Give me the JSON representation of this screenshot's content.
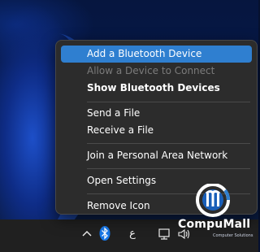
{
  "menu": {
    "items": [
      {
        "label": "Add a Bluetooth Device",
        "state": "highlighted"
      },
      {
        "label": "Allow a Device to Connect",
        "state": "disabled"
      },
      {
        "label": "Show Bluetooth Devices",
        "state": "bold"
      },
      {
        "label": "Send a File",
        "state": "normal"
      },
      {
        "label": "Receive a File",
        "state": "normal"
      },
      {
        "label": "Join a Personal Area Network",
        "state": "normal"
      },
      {
        "label": "Open Settings",
        "state": "normal"
      },
      {
        "label": "Remove Icon",
        "state": "normal"
      }
    ]
  },
  "tray": {
    "chevron_icon": "chevron-up-icon",
    "bluetooth_icon": "bluetooth-icon",
    "ime_indicator": "ع",
    "network_icon": "network-icon",
    "volume_icon": "volume-icon"
  },
  "watermark": {
    "brand": "CompuMall",
    "tagline": "Computer Solutions"
  },
  "colors": {
    "highlight": "#2f7fd0",
    "menu_bg": "#2c2c2c",
    "taskbar_bg": "#202020"
  }
}
